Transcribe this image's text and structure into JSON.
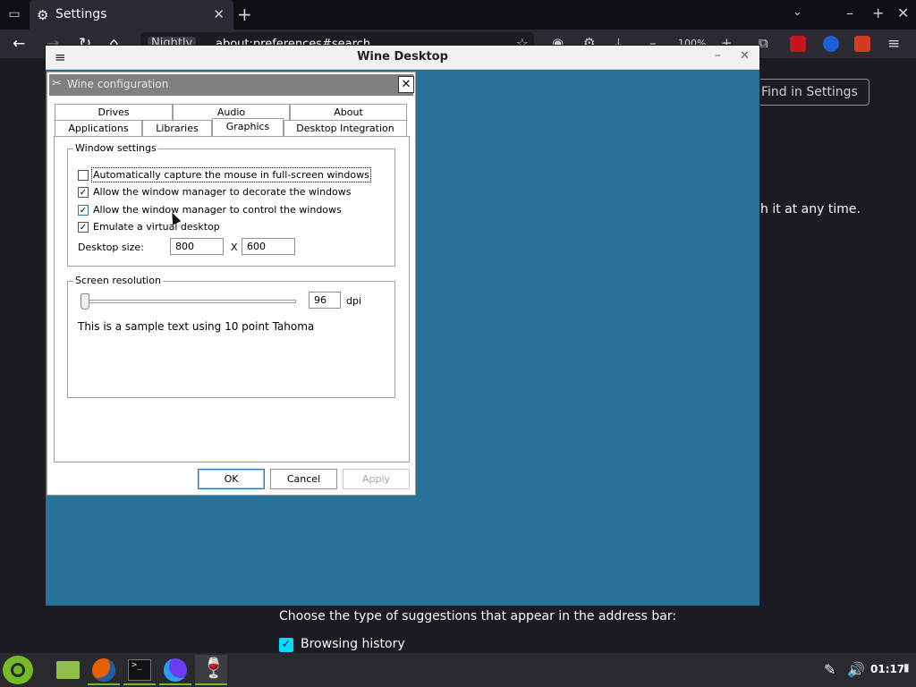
{
  "browser": {
    "tab": {
      "title": "Settings"
    },
    "url_badge": "Nightly",
    "url": "about:preferences#search",
    "zoom": "100%",
    "search_placeholder": "Find in Settings",
    "page_paragraph": "h it at any time.",
    "suggest_heading": "Choose the type of suggestions that appear in the address bar:",
    "browsing_history_label": "Browsing history"
  },
  "wine_desktop": {
    "title": "Wine Desktop"
  },
  "winecfg": {
    "title": "Wine configuration",
    "tabs_row1": [
      "Drives",
      "Audio",
      "About"
    ],
    "tabs_row2": [
      "Applications",
      "Libraries",
      "Graphics",
      "Desktop Integration"
    ],
    "active_tab": "Graphics",
    "window_settings": {
      "label": "Window settings",
      "checkboxes": [
        {
          "label": "Automatically capture the mouse in full-screen windows",
          "checked": false
        },
        {
          "label": "Allow the window manager to decorate the windows",
          "checked": true
        },
        {
          "label": "Allow the window manager to control the windows",
          "checked": true
        },
        {
          "label": "Emulate a virtual desktop",
          "checked": true
        }
      ],
      "desktop_size_label": "Desktop size:",
      "width": "800",
      "separator": "X",
      "height": "600"
    },
    "screen_resolution": {
      "label": "Screen resolution",
      "dpi_value": "96",
      "dpi_unit": "dpi",
      "sample_text": "This is a sample text using 10 point Tahoma"
    },
    "buttons": {
      "ok": "OK",
      "cancel": "Cancel",
      "apply": "Apply"
    }
  },
  "taskbar": {
    "clock": "01:17"
  },
  "colors": {
    "wine_desktop_bg": "#277299",
    "taskbar_accent": "#73ba25",
    "firefox_bg": "#1c1b22"
  }
}
